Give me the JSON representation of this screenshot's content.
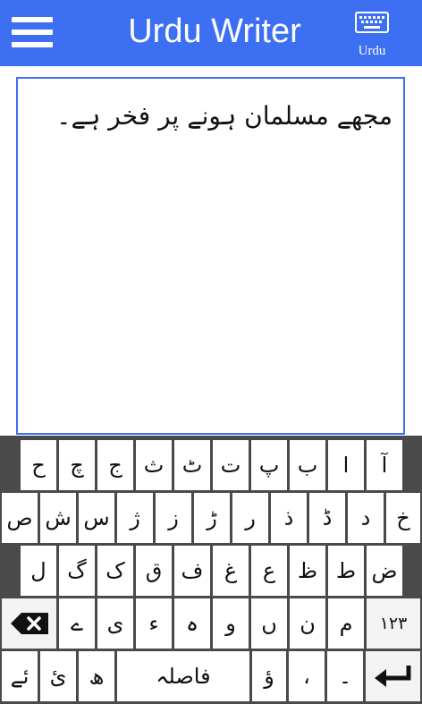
{
  "header": {
    "title": "Urdu Writer",
    "keyboard_label": "Urdu",
    "menu_icon": "hamburger-menu-icon",
    "keyboard_icon": "keyboard-icon",
    "color": "#3d6ff2"
  },
  "editor": {
    "text": "مجھے مسلمان ہونے پر فخر ہے۔"
  },
  "keyboard": {
    "row1": [
      "آ",
      "ا",
      "ب",
      "پ",
      "ت",
      "ٹ",
      "ث",
      "ج",
      "چ",
      "ح"
    ],
    "row2": [
      "خ",
      "د",
      "ڈ",
      "ذ",
      "ر",
      "ڑ",
      "ز",
      "ژ",
      "س",
      "ش",
      "ص"
    ],
    "row3": [
      "ض",
      "ط",
      "ظ",
      "ع",
      "غ",
      "ف",
      "ق",
      "ک",
      "گ",
      "ل"
    ],
    "row4": [
      "١٢٣",
      "م",
      "ن",
      "ں",
      "و",
      "ہ",
      "ء",
      "ی",
      "ے"
    ],
    "row5": {
      "dash": "۔",
      "comma": "،",
      "hamza_waw": "ؤ",
      "space": "فاصلہ",
      "do_chashmi": "ھ",
      "hamza_ye": "ئ",
      "ye_hamza": "ئے"
    },
    "backspace_icon": "backspace-icon",
    "enter_icon": "enter-arrow-icon"
  }
}
